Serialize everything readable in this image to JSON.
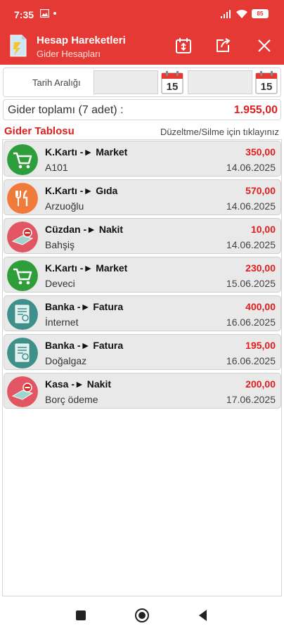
{
  "status": {
    "time": "7:35",
    "battery": "85"
  },
  "header": {
    "title": "Hesap Hareketleri",
    "subtitle": "Gider Hesapları"
  },
  "filter": {
    "label": "Tarih Aralığı",
    "start_date": "",
    "end_date": "",
    "calendar_day": "15"
  },
  "summary": {
    "label": "Gider toplamı (7 adet) :",
    "total": "1.955,00"
  },
  "table": {
    "title": "Gider Tablosu",
    "hint": "Düzeltme/Silme için tıklayınız"
  },
  "rows": [
    {
      "category": "K.Kartı -► Market",
      "description": "A101",
      "amount": "350,00",
      "date": "14.06.2025",
      "icon": "shopping-cart-icon",
      "color": "#2e9e3a"
    },
    {
      "category": "K.Kartı -► Gıda",
      "description": "Arzuoğlu",
      "amount": "570,00",
      "date": "14.06.2025",
      "icon": "fork-knife-icon",
      "color": "#f07a3a"
    },
    {
      "category": "Cüzdan -► Nakit",
      "description": "Bahşiş",
      "amount": "10,00",
      "date": "14.06.2025",
      "icon": "cash-minus-icon",
      "color": "#e25562"
    },
    {
      "category": "K.Kartı -► Market",
      "description": "Deveci",
      "amount": "230,00",
      "date": "15.06.2025",
      "icon": "shopping-cart-icon",
      "color": "#2e9e3a"
    },
    {
      "category": "Banka -► Fatura",
      "description": "İnternet",
      "amount": "400,00",
      "date": "16.06.2025",
      "icon": "invoice-icon",
      "color": "#3f8f8a"
    },
    {
      "category": "Banka -► Fatura",
      "description": "Doğalgaz",
      "amount": "195,00",
      "date": "16.06.2025",
      "icon": "invoice-icon",
      "color": "#3f8f8a"
    },
    {
      "category": "Kasa -► Nakit",
      "description": "Borç ödeme",
      "amount": "200,00",
      "date": "17.06.2025",
      "icon": "cash-minus-icon",
      "color": "#e25562"
    }
  ],
  "colors": {
    "primary": "#e53935",
    "accent_red": "#e01e1e"
  }
}
